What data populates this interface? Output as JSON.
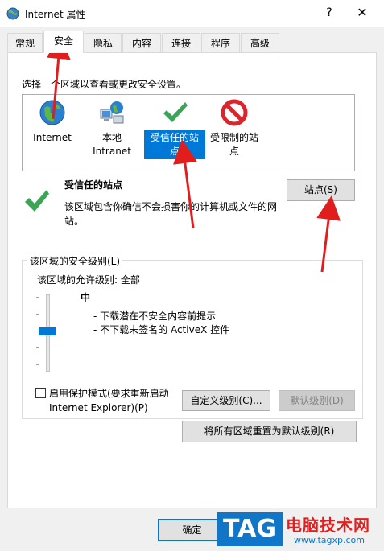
{
  "window": {
    "title": "Internet 属性",
    "help": "?",
    "close": "✕"
  },
  "tabs": [
    {
      "label": "常规"
    },
    {
      "label": "安全"
    },
    {
      "label": "隐私"
    },
    {
      "label": "内容"
    },
    {
      "label": "连接"
    },
    {
      "label": "程序"
    },
    {
      "label": "高级"
    }
  ],
  "active_tab": "安全",
  "security": {
    "zone_prompt": "选择一个区域以查看或更改安全设置。",
    "zones": [
      {
        "label": "Internet",
        "icon": "globe-icon"
      },
      {
        "label": "本地\nIntranet",
        "icon": "local-intranet-icon"
      },
      {
        "label": "受信任的站\n点",
        "icon": "trusted-check-icon"
      },
      {
        "label": "受限制的站\n点",
        "icon": "restricted-icon"
      }
    ],
    "selected_zone": {
      "title": "受信任的站点",
      "description": "该区域包含你确信不会损害你的计算机或文件的网站。",
      "sites_button": "站点(S)"
    },
    "level_group": {
      "legend": "该区域的安全级别(L)",
      "allowed": "该区域的允许级别: 全部",
      "level_name": "中",
      "details": [
        "- 下载潜在不安全内容前提示",
        "- 不下载未签名的 ActiveX 控件"
      ],
      "slider_level": 0.5
    },
    "protected_mode": {
      "label": "启用保护模式(要求重新启动 Internet Explorer)(P)",
      "checked": false
    },
    "custom_button": "自定义级别(C)...",
    "default_button": "默认级别(D)",
    "reset_all_button": "将所有区域重置为默认级别(R)"
  },
  "footer": {
    "ok_button": "确定"
  },
  "watermark": {
    "tag": "TAG",
    "site_name": "电脑技术网",
    "url": "www.tagxp.com"
  },
  "colors": {
    "accent": "#0078d7",
    "annotation_arrow": "#e01e1e",
    "trusted_green": "#3aa655",
    "restricted_red": "#d9262c"
  }
}
